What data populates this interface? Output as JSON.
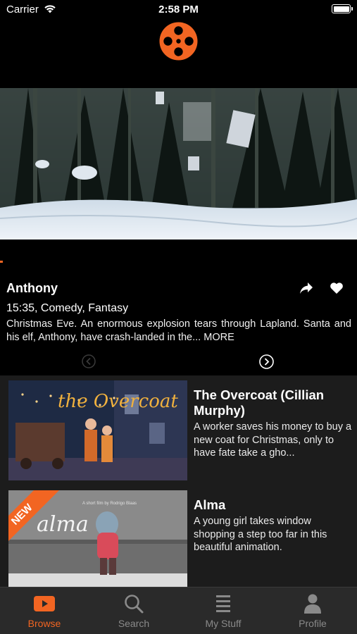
{
  "status_bar": {
    "carrier": "Carrier",
    "time": "2:58 PM"
  },
  "featured": {
    "title": "Anthony",
    "meta": "15:35, Comedy, Fantasy",
    "description": "Christmas Eve. An enormous explosion tears through Lapland. Santa and his elf, Anthony, have crash-landed in the...",
    "more_label": "MORE"
  },
  "list": [
    {
      "title": "The Overcoat (Cillian Murphy)",
      "description": "A worker saves his money to buy a new coat for Christmas, only to have fate take a gho...",
      "thumb_text": "the Overcoat"
    },
    {
      "title": "Alma",
      "description": "A young girl takes window shopping a step too far in this beautiful animation.",
      "badge": "NEW",
      "thumb_text": "alma",
      "thumb_credit": "A short film by Rodrigo Blaas"
    }
  ],
  "tabs": [
    {
      "label": "Browse",
      "icon": "play-icon",
      "active": true
    },
    {
      "label": "Search",
      "icon": "search-icon",
      "active": false
    },
    {
      "label": "My Stuff",
      "icon": "list-icon",
      "active": false
    },
    {
      "label": "Profile",
      "icon": "person-icon",
      "active": false
    }
  ],
  "colors": {
    "accent": "#f26522",
    "background": "#000000",
    "list_bg": "#1c1c1c",
    "tab_bar_bg": "#2a2a2a"
  }
}
